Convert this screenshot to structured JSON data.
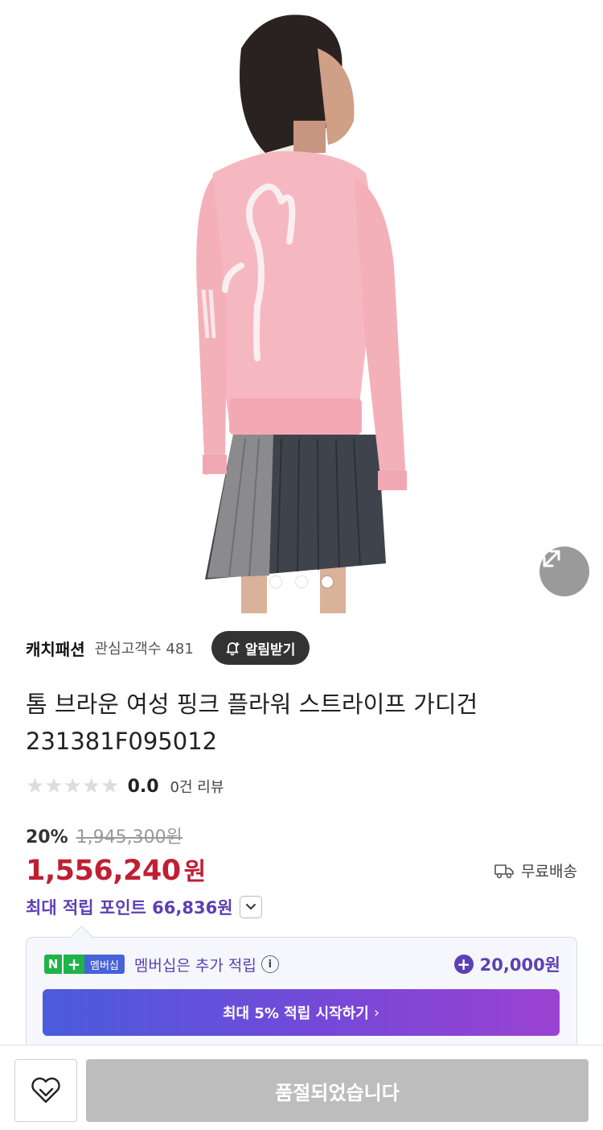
{
  "hero": {
    "icon": "expand-icon",
    "dots_count": 3,
    "active_dot": 1
  },
  "seller": {
    "name": "캐치패션",
    "fans_label": "관심고객수",
    "fans_count": "481",
    "alarm_label": "알림받기",
    "alarm_icon": "bell-plus-icon"
  },
  "product": {
    "title_line1": "톰 브라운 여성 핑크 플라워 스트라이프 가디건",
    "title_line2": "231381F095012"
  },
  "rating": {
    "stars_filled": 0,
    "stars_total": 5,
    "score": "0.0",
    "review_count": "0건 리뷰"
  },
  "price": {
    "discount": "20%",
    "original": "1,945,300원",
    "sale": "1,556,240",
    "currency": "원",
    "shipping": "무료배송",
    "shipping_icon": "truck-icon",
    "color": "#c01f33"
  },
  "points": {
    "label": "최대 적립 포인트 66,836원",
    "toggle_icon": "chevron-down-icon",
    "color": "#5d3fb5"
  },
  "membership": {
    "badge_n": "N",
    "badge_plus": "+",
    "badge_label": "멤버십",
    "text": "멤버십은 추가 적립",
    "info": "i",
    "plus": "+",
    "amount": "20,000원",
    "button_label": "최대 5% 적립 시작하기",
    "button_chevron": "›"
  },
  "bottom": {
    "wish_icon": "heart-icon",
    "soldout_label": "품절되었습니다"
  }
}
